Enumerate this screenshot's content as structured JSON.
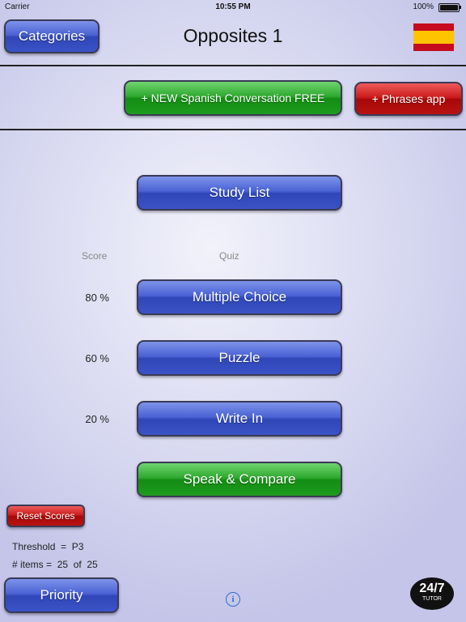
{
  "status_bar": {
    "carrier": "Carrier",
    "time": "10:55 PM",
    "battery": "100%"
  },
  "header": {
    "title": "Opposites 1",
    "categories_label": "Categories",
    "flag_icon": "spain-flag-icon"
  },
  "promo": {
    "conversation_label": "+ NEW  Spanish Conversation  FREE",
    "phrases_label": "+ Phrases app"
  },
  "main": {
    "study_list_label": "Study List",
    "score_header": "Score",
    "quiz_header": "Quiz",
    "quizzes": [
      {
        "score": "80 %",
        "label": "Multiple Choice"
      },
      {
        "score": "60 %",
        "label": "Puzzle"
      },
      {
        "score": "20 %",
        "label": "Write In"
      }
    ],
    "speak_label": "Speak & Compare"
  },
  "footer": {
    "reset_label": "Reset Scores",
    "threshold_text": "Threshold  =  P3",
    "items_text": "# items =  25  of  25",
    "priority_label": "Priority",
    "info_glyph": "i",
    "tutor_big": "24/7",
    "tutor_small": "TUTOR"
  },
  "colors": {
    "blue": "#4a62d4",
    "green": "#2fa82f",
    "red": "#cc1c1c"
  }
}
